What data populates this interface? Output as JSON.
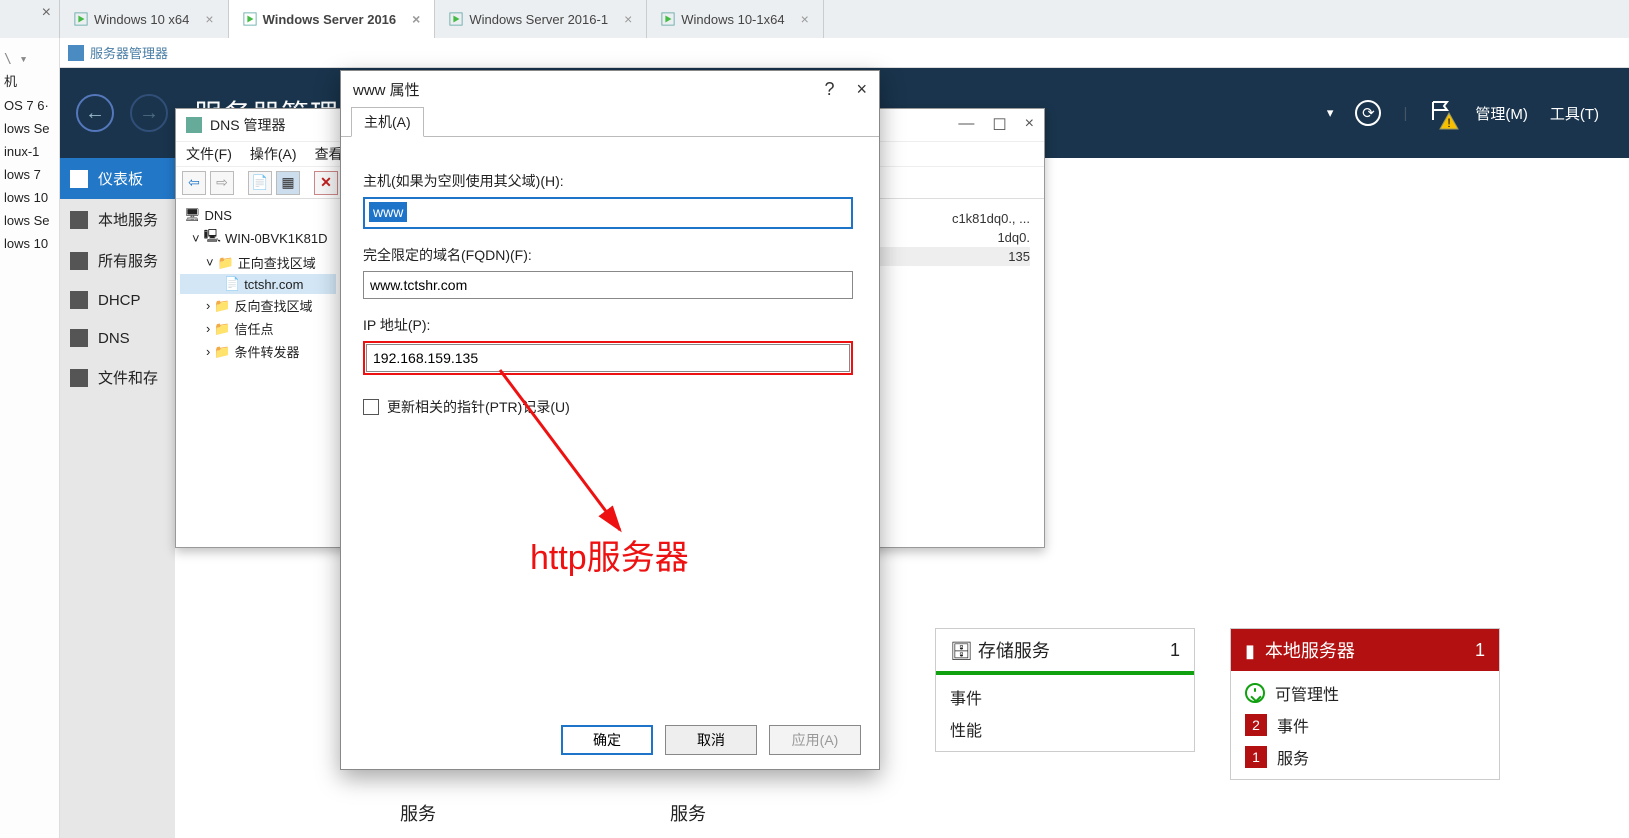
{
  "vm_tabs": {
    "close_glyph": "×",
    "items": [
      {
        "label": "Windows 10 x64",
        "active": false
      },
      {
        "label": "Windows Server 2016",
        "active": true
      },
      {
        "label": "Windows Server 2016-1",
        "active": false
      },
      {
        "label": "Windows 10-1x64",
        "active": false
      }
    ]
  },
  "left_strip": {
    "prompt": "\\ ▾",
    "items": [
      "机",
      "OS 7 6·",
      "lows Se",
      "inux-1",
      "lows 7",
      "lows 10",
      "lows Se",
      "lows 10"
    ]
  },
  "subbar": {
    "title": "服务器管理器"
  },
  "srv_header": {
    "title": "服务器管理",
    "menu": {
      "manage": "管理(M)",
      "tools": "工具(T)"
    }
  },
  "srv_sidebar": {
    "items": [
      {
        "label": "仪表板",
        "sel": true,
        "name": "dashboard"
      },
      {
        "label": "本地服务",
        "sel": false,
        "name": "local-server"
      },
      {
        "label": "所有服务",
        "sel": false,
        "name": "all-servers"
      },
      {
        "label": "DHCP",
        "sel": false,
        "name": "dhcp"
      },
      {
        "label": "DNS",
        "sel": false,
        "name": "dns"
      },
      {
        "label": "文件和存",
        "sel": false,
        "name": "file-storage"
      }
    ]
  },
  "dns_win": {
    "title": "DNS 管理器",
    "menu": [
      "文件(F)",
      "操作(A)",
      "查看"
    ],
    "tree": {
      "root": "DNS",
      "server": "WIN-0BVK1K81D",
      "nodes": [
        {
          "label": "正向查找区域",
          "children": [
            {
              "label": "tctshr.com",
              "sel": true
            }
          ]
        },
        {
          "label": "反向查找区域"
        },
        {
          "label": "信任点"
        },
        {
          "label": "条件转发器"
        }
      ]
    },
    "records": {
      "rows": [
        "c1k81dq0., ...",
        "1dq0.",
        "135"
      ]
    }
  },
  "prop": {
    "title": "www 属性",
    "help": "?",
    "close": "×",
    "tab": "主机(A)",
    "host_label": "主机(如果为空则使用其父域)(H):",
    "host_value": "www",
    "fqdn_label": "完全限定的域名(FQDN)(F):",
    "fqdn_value": "www.tctshr.com",
    "ip_label": "IP 地址(P):",
    "ip_value": "192.168.159.135",
    "ptr_label": "更新相关的指针(PTR)记录(U)",
    "buttons": {
      "ok": "确定",
      "cancel": "取消",
      "apply": "应用(A)"
    }
  },
  "annotation": {
    "text": "http服务器"
  },
  "tiles": {
    "storage": {
      "title": "存储服务",
      "count": "1",
      "rows": [
        "事件",
        "性能"
      ]
    },
    "local": {
      "title": "本地服务器",
      "count": "1",
      "manage": "可管理性",
      "event_badge": "2",
      "event": "事件",
      "service_badge": "1",
      "service": "服务"
    }
  },
  "bottom_labels": {
    "a": "服务",
    "b": "服务"
  }
}
